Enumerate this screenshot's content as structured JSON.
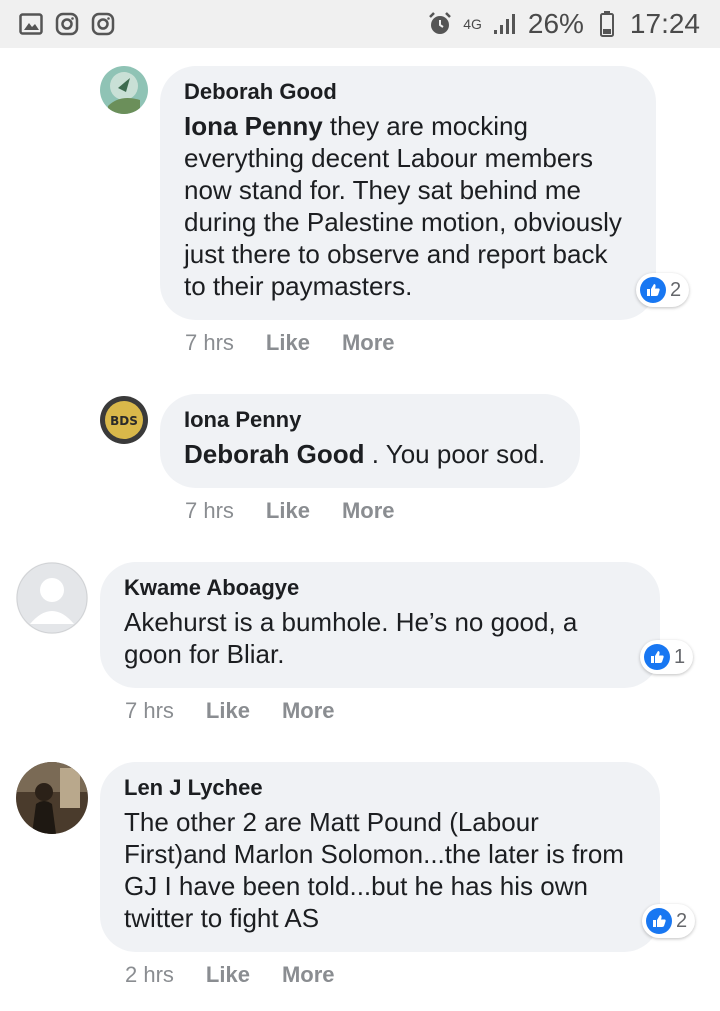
{
  "status_bar": {
    "left_icons": [
      "gallery-icon",
      "instagram-icon",
      "instagram-icon"
    ],
    "network": "4G",
    "battery": "26%",
    "time": "17:24"
  },
  "comments": [
    {
      "author": "Deborah Good",
      "mention": "Iona Penny",
      "text": " they are mocking everything decent Labour members now stand for. They sat behind me during the Palestine motion, obviously just there to observe and report back to their paymasters.",
      "reactions": "2",
      "time": "7 hrs",
      "like_label": "Like",
      "more_label": "More"
    },
    {
      "author": "Iona Penny",
      "mention": "Deborah Good",
      "text": " . You poor sod.",
      "avatar_badge": "BDS",
      "time": "7 hrs",
      "like_label": "Like",
      "more_label": "More"
    },
    {
      "author": "Kwame Aboagye",
      "text": "Akehurst is a bumhole. He’s no good, a goon for Bliar.",
      "reactions": "1",
      "time": "7 hrs",
      "like_label": "Like",
      "more_label": "More"
    },
    {
      "author": "Len J Lychee",
      "text": "The other 2 are Matt Pound (Labour First)and Marlon Solomon...the later is from GJ I have been told...but he has his own twitter to fight AS",
      "reactions": "2",
      "time": "2 hrs",
      "like_label": "Like",
      "more_label": "More"
    }
  ],
  "colors": {
    "bubble": "#f0f2f5",
    "like_blue": "#1877f2",
    "meta": "#8a8d91"
  }
}
